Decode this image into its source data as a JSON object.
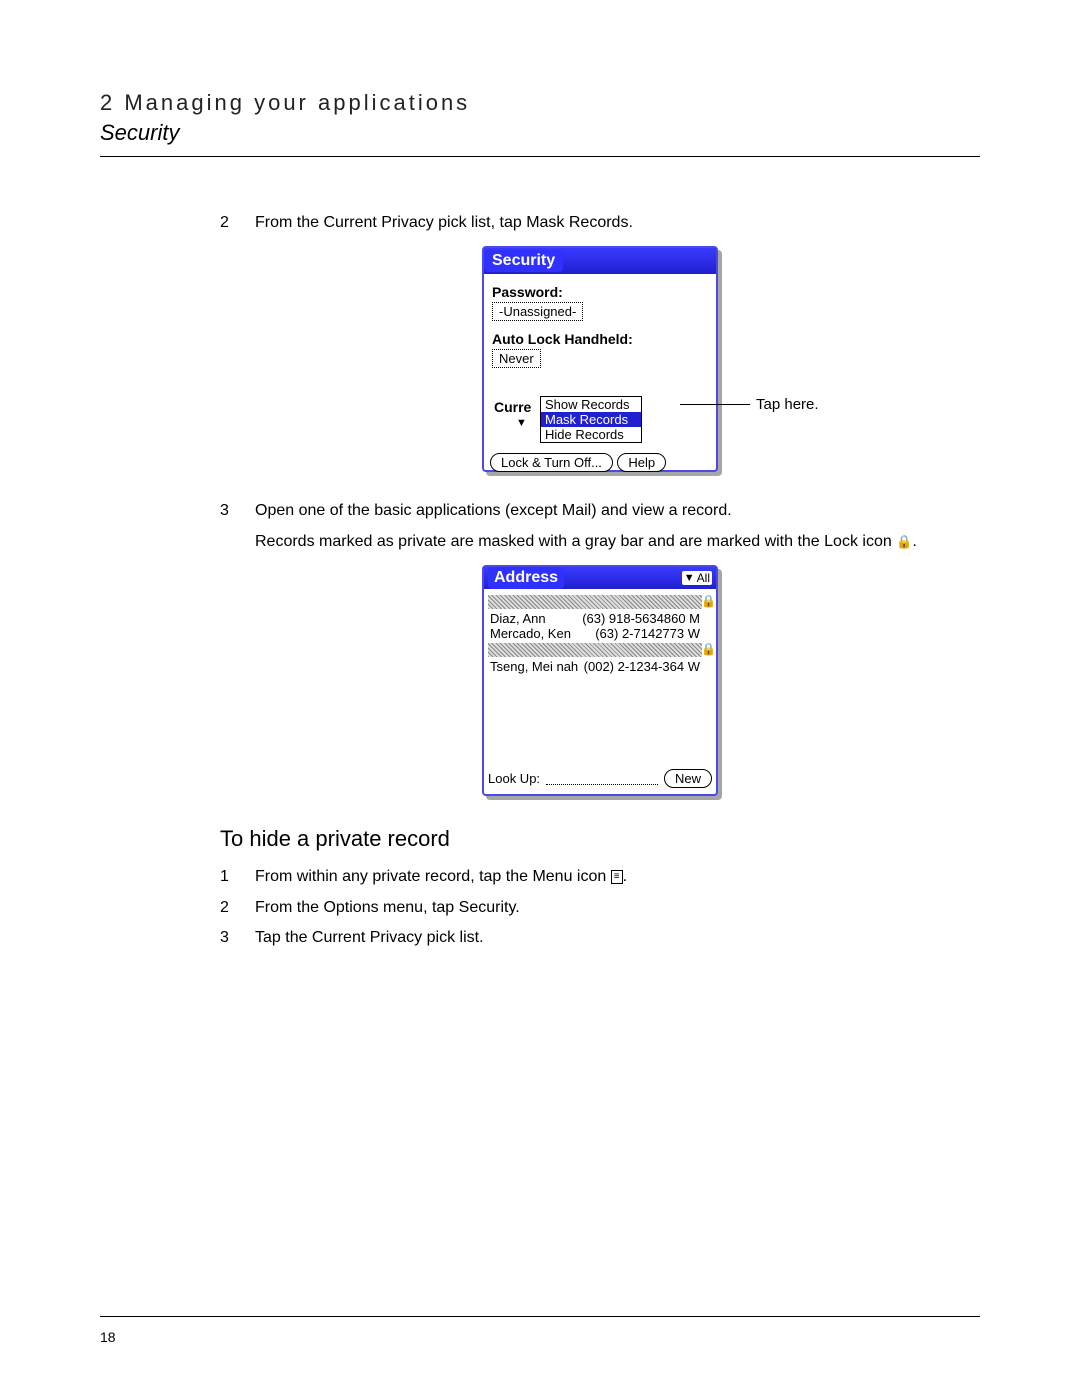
{
  "header": {
    "chapter": "2 Managing your applications",
    "section": "Security"
  },
  "steps_top": [
    {
      "num": "2",
      "text": "From the Current Privacy pick list, tap Mask Records."
    }
  ],
  "security_screen": {
    "title": "Security",
    "password_label": "Password:",
    "password_value": "-Unassigned-",
    "autolock_label": "Auto Lock Handheld:",
    "autolock_value": "Never",
    "current_label_trunc": "Curre",
    "picklist": {
      "options": [
        "Show Records",
        "Mask Records",
        "Hide Records"
      ],
      "selected_index": 1
    },
    "lock_button": "Lock & Turn Off...",
    "help_button": "Help",
    "callout": "Tap here."
  },
  "steps_mid": [
    {
      "num": "3",
      "text": "Open one of the basic applications (except Mail) and view a record."
    }
  ],
  "mid_followup": "Records marked as private are masked with a gray bar and are marked with the Lock icon",
  "mid_followup_end": ".",
  "address_screen": {
    "title": "Address",
    "category": "All",
    "rows": [
      {
        "type": "masked"
      },
      {
        "type": "entry",
        "name": "Diaz, Ann",
        "phone": "(63) 918-5634860 M"
      },
      {
        "type": "entry",
        "name": "Mercado, Ken",
        "phone": "(63) 2-7142773 W"
      },
      {
        "type": "masked"
      },
      {
        "type": "entry",
        "name": "Tseng, Mei nah",
        "phone": "(002) 2-1234-364 W"
      }
    ],
    "lookup_label": "Look Up:",
    "new_button": "New"
  },
  "subheading": "To hide a private record",
  "steps_bottom": [
    {
      "num": "1",
      "text_before": "From within any private record, tap the Menu icon ",
      "text_after": "."
    },
    {
      "num": "2",
      "text": "From the Options menu, tap Security."
    },
    {
      "num": "3",
      "text": "Tap the Current Privacy pick list."
    }
  ],
  "page_number": "18"
}
